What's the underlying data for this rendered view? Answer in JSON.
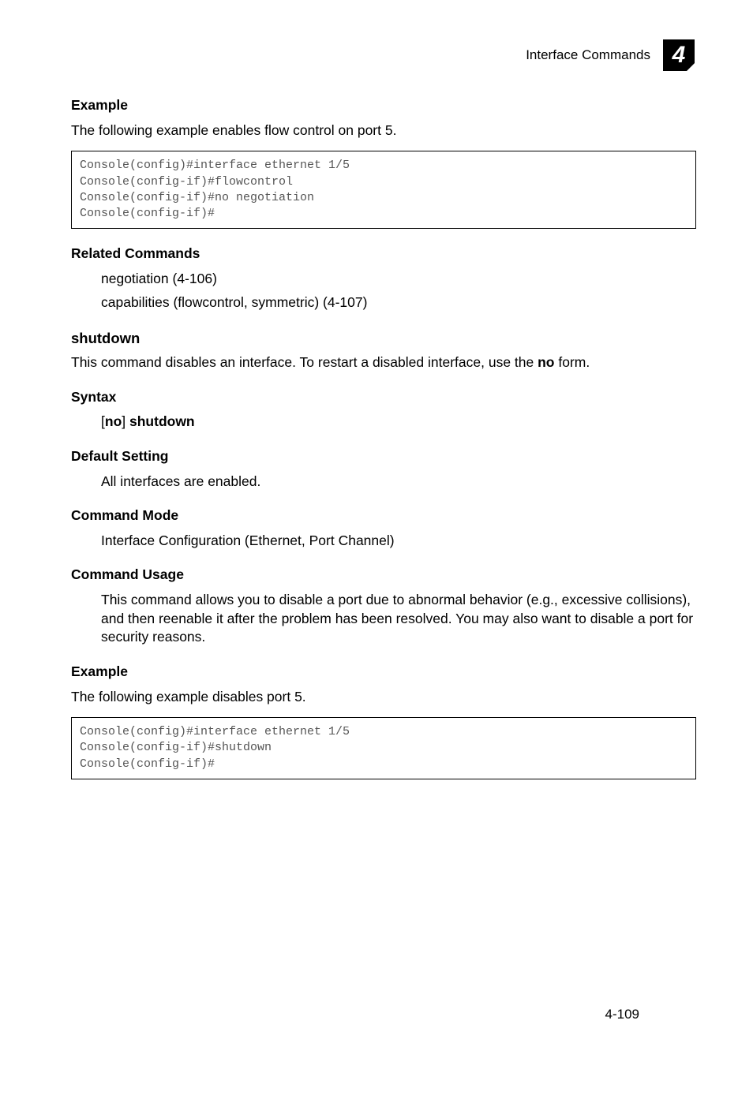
{
  "header": {
    "section": "Interface Commands",
    "chapterIcon": "4"
  },
  "example1": {
    "heading": "Example",
    "intro": "The following example enables flow control on port 5.",
    "code": "Console(config)#interface ethernet 1/5\nConsole(config-if)#flowcontrol\nConsole(config-if)#no negotiation\nConsole(config-if)#"
  },
  "related": {
    "heading": "Related Commands",
    "line1": "negotiation (4-106)",
    "line2": "capabilities (flowcontrol, symmetric) (4-107)"
  },
  "shutdown": {
    "heading": "shutdown",
    "desc_prefix": "This command disables an interface. To restart a disabled interface, use the ",
    "desc_bold": "no",
    "desc_suffix": " form."
  },
  "syntax": {
    "heading": "Syntax",
    "bracket_open": "[",
    "no": "no",
    "bracket_close": "] ",
    "cmd": "shutdown"
  },
  "default": {
    "heading": "Default Setting",
    "body": "All interfaces are enabled."
  },
  "mode": {
    "heading": "Command Mode",
    "body": "Interface Configuration (Ethernet, Port Channel)"
  },
  "usage": {
    "heading": "Command Usage",
    "body": "This command allows you to disable a port due to abnormal behavior (e.g., excessive collisions), and then reenable it after the problem has been resolved. You may also want to disable a port for security reasons."
  },
  "example2": {
    "heading": "Example",
    "intro": "The following example disables port 5.",
    "code": "Console(config)#interface ethernet 1/5\nConsole(config-if)#shutdown\nConsole(config-if)#"
  },
  "pageNumber": "4-109"
}
